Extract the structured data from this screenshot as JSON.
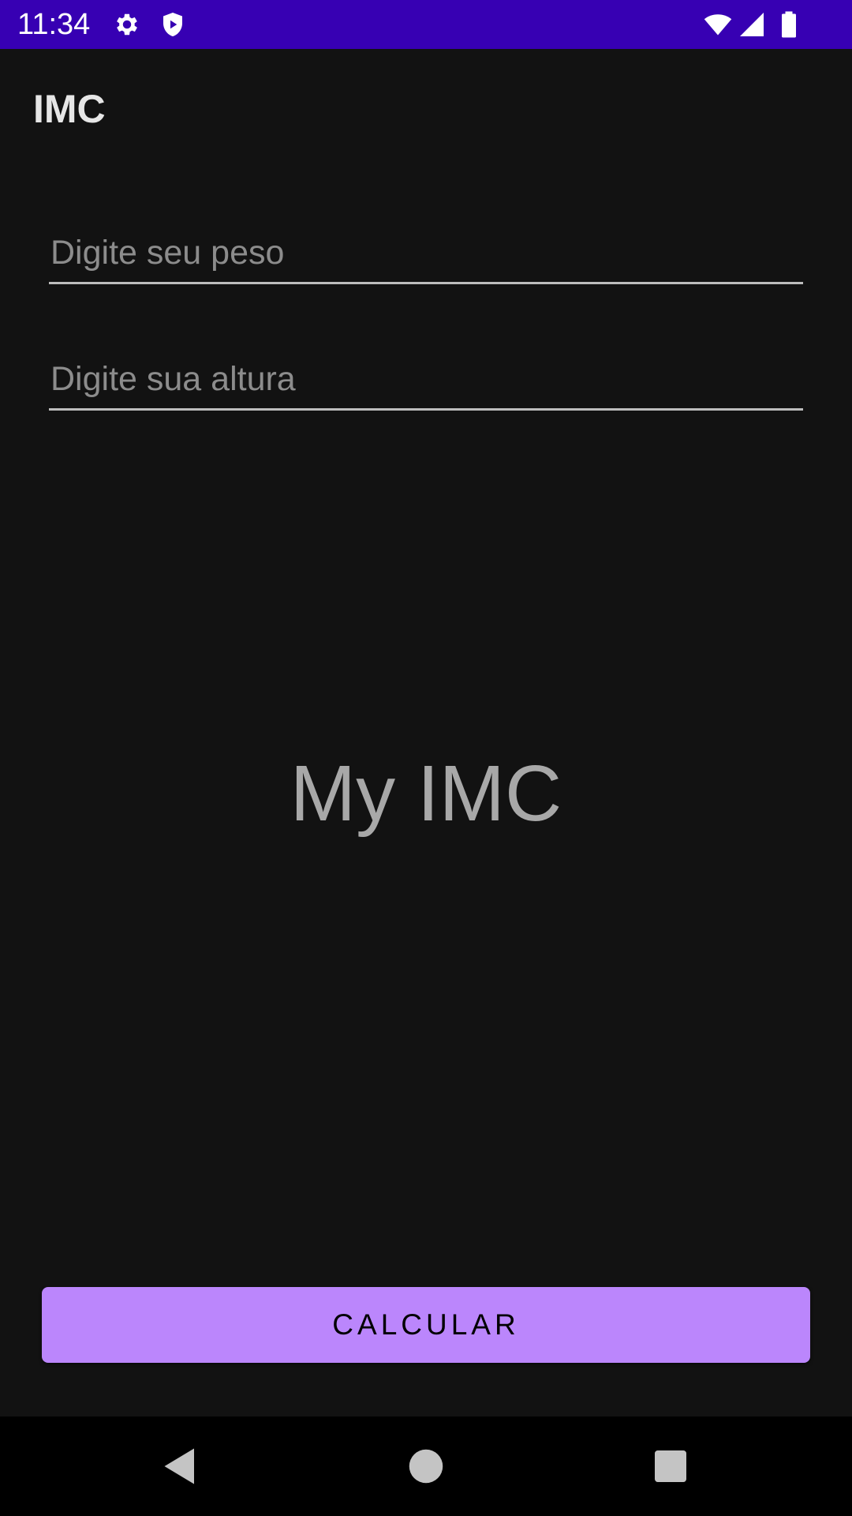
{
  "status_bar": {
    "time": "11:34",
    "background": "#3700B3",
    "icons": [
      "gear-icon",
      "shield-icon",
      "wifi-icon",
      "signal-icon",
      "battery-icon"
    ]
  },
  "app_bar": {
    "title": "IMC"
  },
  "form": {
    "weight": {
      "value": "",
      "placeholder": "Digite seu peso"
    },
    "height": {
      "value": "",
      "placeholder": "Digite sua altura"
    }
  },
  "result": {
    "text": "My IMC"
  },
  "button": {
    "label": "CALCULAR",
    "color": "#BB86FC"
  },
  "nav_bar": {
    "icons": [
      "back-icon",
      "home-icon",
      "recents-icon"
    ]
  },
  "colors": {
    "background": "#121212",
    "text_primary": "#E6E6E6",
    "text_hint": "#8C8C8C",
    "underline": "#BDBDBD"
  }
}
